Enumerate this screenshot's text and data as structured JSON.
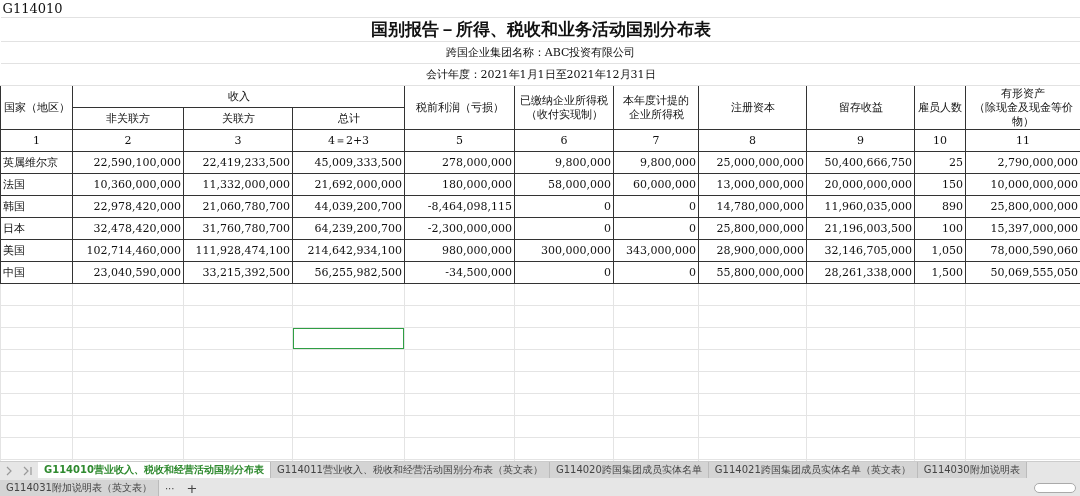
{
  "sheet": {
    "code": "G114010",
    "title": "国别报告－所得、税收和业务活动国别分布表",
    "group_name": "跨国企业集团名称：ABC投资有限公司",
    "period": "会计年度：2021年1月1日至2021年12月31日",
    "header_rows": [
      [
        {
          "lines": [
            "国家（地区）"
          ],
          "rowspan": 2
        },
        {
          "lines": [
            "收入"
          ],
          "colspan": 3
        },
        {
          "lines": [
            "税前利润（亏损）"
          ],
          "rowspan": 2
        },
        {
          "lines": [
            "已缴纳企业所得税",
            "（收付实现制）"
          ],
          "rowspan": 2
        },
        {
          "lines": [
            "本年度计提的",
            "企业所得税"
          ],
          "rowspan": 2
        },
        {
          "lines": [
            "注册资本"
          ],
          "rowspan": 2
        },
        {
          "lines": [
            "留存收益"
          ],
          "rowspan": 2
        },
        {
          "lines": [
            "雇员人数"
          ],
          "rowspan": 2
        },
        {
          "lines": [
            "有形资产",
            "（除现金及现金等价",
            "物）"
          ],
          "rowspan": 2
        }
      ],
      [
        {
          "lines": [
            "非关联方"
          ]
        },
        {
          "lines": [
            "关联方"
          ]
        },
        {
          "lines": [
            "总计"
          ]
        }
      ]
    ],
    "column_numbers": [
      "1",
      "2",
      "3",
      "4＝2+3",
      "5",
      "6",
      "7",
      "8",
      "9",
      "10",
      "11"
    ],
    "rows": [
      [
        "英属维尔京",
        "22,590,100,000",
        "22,419,233,500",
        "45,009,333,500",
        "278,000,000",
        "9,800,000",
        "9,800,000",
        "25,000,000,000",
        "50,400,666,750",
        "25",
        "2,790,000,000"
      ],
      [
        "法国",
        "10,360,000,000",
        "11,332,000,000",
        "21,692,000,000",
        "180,000,000",
        "58,000,000",
        "60,000,000",
        "13,000,000,000",
        "20,000,000,000",
        "150",
        "10,000,000,000"
      ],
      [
        "韩国",
        "22,978,420,000",
        "21,060,780,700",
        "44,039,200,700",
        "-8,464,098,115",
        "0",
        "0",
        "14,780,000,000",
        "11,960,035,000",
        "890",
        "25,800,000,000"
      ],
      [
        "日本",
        "32,478,420,000",
        "31,760,780,700",
        "64,239,200,700",
        "-2,300,000,000",
        "0",
        "0",
        "25,800,000,000",
        "21,196,003,500",
        "100",
        "15,397,000,000"
      ],
      [
        "美国",
        "102,714,460,000",
        "111,928,474,100",
        "214,642,934,100",
        "980,000,000",
        "300,000,000",
        "343,000,000",
        "28,900,000,000",
        "32,146,705,000",
        "1,050",
        "78,000,590,060"
      ],
      [
        "中国",
        "23,040,590,000",
        "33,215,392,500",
        "56,255,982,500",
        "-34,500,000",
        "0",
        "0",
        "55,800,000,000",
        "28,261,338,000",
        "1,500",
        "50,069,555,050"
      ]
    ]
  },
  "sheet_tabs": [
    {
      "label": "G114010营业收入、税收和经营活动国别分布表",
      "selected": true
    },
    {
      "label": "G114011营业收入、税收和经营活动国别分布表（英文表）",
      "selected": false
    },
    {
      "label": "G114020跨国集团成员实体名单",
      "selected": false
    },
    {
      "label": "G114021跨国集团成员实体名单（英文表）",
      "selected": false
    },
    {
      "label": "G114030附加说明表",
      "selected": false
    },
    {
      "label": "G114031附加说明表（英文表）",
      "selected": false
    }
  ],
  "more_tabs": "···",
  "add_tab": "+"
}
